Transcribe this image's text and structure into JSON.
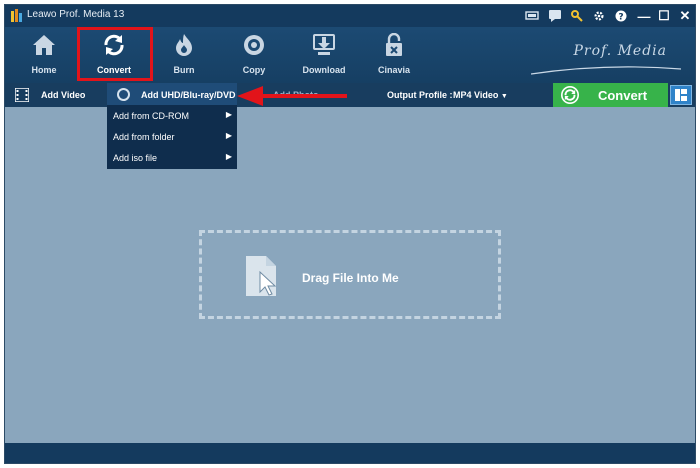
{
  "window": {
    "title": "Leawo Prof. Media 13"
  },
  "titlebar_icons": [
    "cart-icon",
    "chat-icon",
    "key-icon",
    "gear-icon",
    "help-icon"
  ],
  "window_controls": {
    "minimize": "—",
    "maximize": "☐",
    "close": "✕"
  },
  "nav": {
    "items": [
      {
        "label": "Home",
        "icon": "home-icon"
      },
      {
        "label": "Convert",
        "icon": "convert-icon",
        "active": true
      },
      {
        "label": "Burn",
        "icon": "burn-icon"
      },
      {
        "label": "Copy",
        "icon": "copy-icon"
      },
      {
        "label": "Download",
        "icon": "download-icon"
      },
      {
        "label": "Cinavia",
        "icon": "cinavia-icon"
      }
    ],
    "brand": "Prof. Media"
  },
  "subbar": {
    "add_video": "Add Video",
    "add_photo_partial": "Add Photo",
    "output_profile_label": "Output Profile :",
    "output_profile_value": "MP4 Video",
    "convert_button": "Convert"
  },
  "dropdown": {
    "header": "Add UHD/Blu-ray/DVD",
    "items": [
      {
        "label": "Add from CD-ROM",
        "has_submenu": true
      },
      {
        "label": "Add from folder",
        "has_submenu": true
      },
      {
        "label": "Add iso file",
        "has_submenu": true
      }
    ]
  },
  "dropzone": {
    "label": "Drag File Into Me"
  },
  "colors": {
    "accent_green": "#37b34a",
    "highlight_red": "#e2141a",
    "workspace": "#8aa6bd",
    "toolbar": "#1c4a73"
  }
}
